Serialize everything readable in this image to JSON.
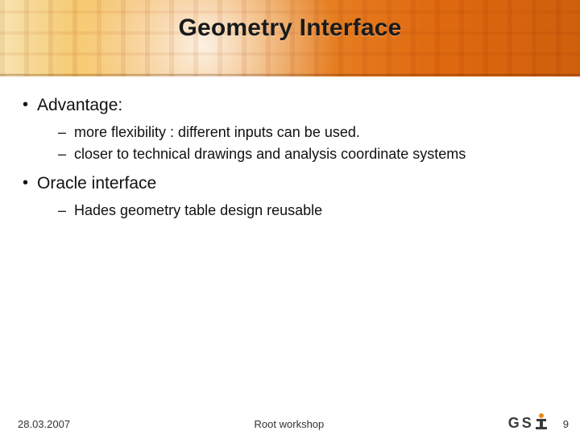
{
  "title": "Geometry Interface",
  "bullets": {
    "b1": {
      "label": "Advantage:"
    },
    "b1_subs": [
      "more flexibility : different inputs can be used.",
      "closer to technical drawings and analysis coordinate systems"
    ],
    "b2": {
      "label": "Oracle interface"
    },
    "b2_subs": [
      "Hades geometry table design reusable"
    ]
  },
  "footer": {
    "date": "28.03.2007",
    "center": "Root workshop",
    "logo_text": {
      "g": "G",
      "s": "S"
    },
    "page": "9"
  }
}
